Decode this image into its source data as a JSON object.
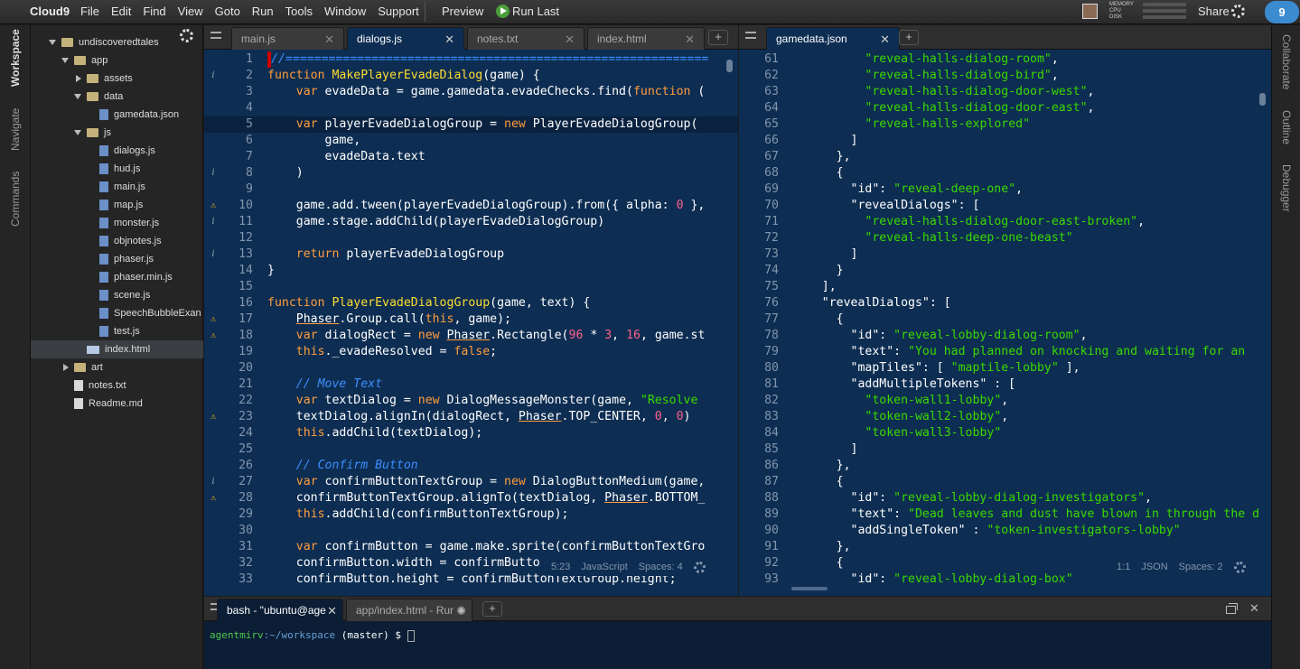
{
  "menubar": {
    "logo": "Cloud9",
    "menus": [
      "File",
      "Edit",
      "Find",
      "View",
      "Goto",
      "Run",
      "Tools",
      "Window",
      "Support"
    ],
    "preview": "Preview",
    "run_last": "Run Last",
    "meters": [
      "MEMORY",
      "CPU",
      "DISK"
    ],
    "share": "Share"
  },
  "left_rail": {
    "tabs": [
      "Workspace",
      "Navigate",
      "Commands"
    ]
  },
  "right_rail": {
    "tabs": [
      "Collaborate",
      "Outline",
      "Debugger"
    ]
  },
  "tree": {
    "items": [
      {
        "label": "undiscoveredtales",
        "type": "folder",
        "open": true,
        "depth": 0
      },
      {
        "label": "app",
        "type": "folder",
        "open": true,
        "depth": 1
      },
      {
        "label": "assets",
        "type": "folder",
        "open": false,
        "depth": 2
      },
      {
        "label": "data",
        "type": "folder",
        "open": true,
        "depth": 2
      },
      {
        "label": "gamedata.json",
        "type": "json",
        "depth": 3
      },
      {
        "label": "js",
        "type": "folder",
        "open": true,
        "depth": 2
      },
      {
        "label": "dialogs.js",
        "type": "js",
        "depth": 3
      },
      {
        "label": "hud.js",
        "type": "js",
        "depth": 3
      },
      {
        "label": "main.js",
        "type": "js",
        "depth": 3
      },
      {
        "label": "map.js",
        "type": "js",
        "depth": 3
      },
      {
        "label": "monster.js",
        "type": "js",
        "depth": 3
      },
      {
        "label": "objnotes.js",
        "type": "js",
        "depth": 3
      },
      {
        "label": "phaser.js",
        "type": "js",
        "depth": 3
      },
      {
        "label": "phaser.min.js",
        "type": "js",
        "depth": 3
      },
      {
        "label": "scene.js",
        "type": "js",
        "depth": 3
      },
      {
        "label": "SpeechBubbleExan",
        "type": "js",
        "depth": 3
      },
      {
        "label": "test.js",
        "type": "js",
        "depth": 3
      },
      {
        "label": "index.html",
        "type": "html",
        "depth": 2,
        "selected": true
      },
      {
        "label": "art",
        "type": "folder",
        "open": false,
        "depth": 1
      },
      {
        "label": "notes.txt",
        "type": "txt",
        "depth": 1
      },
      {
        "label": "Readme.md",
        "type": "txt",
        "depth": 1
      }
    ]
  },
  "left_pane": {
    "tabs": [
      "main.js",
      "dialogs.js",
      "notes.txt",
      "index.html"
    ],
    "active_tab": 1,
    "status": {
      "cursor": "5:23",
      "mode": "JavaScript",
      "spaces": "Spaces: 4"
    },
    "lines": [
      {
        "n": "1",
        "ann": "",
        "t": [
          [
            "c",
            "//==========================================================="
          ]
        ]
      },
      {
        "n": "2",
        "ann": "i",
        "t": [
          [
            "k",
            "function "
          ],
          [
            "f",
            "MakePlayerEvadeDialog"
          ],
          [
            "p",
            "(game) {"
          ]
        ]
      },
      {
        "n": "3",
        "ann": "",
        "t": [
          [
            "p",
            "    "
          ],
          [
            "k",
            "var "
          ],
          [
            "p",
            "evadeData = game.gamedata.evadeChecks."
          ],
          [
            "w",
            "find"
          ],
          [
            "p",
            "("
          ],
          [
            "k",
            "function"
          ],
          [
            "p",
            " ("
          ]
        ]
      },
      {
        "n": "4",
        "ann": "",
        "t": [
          [
            "p",
            ""
          ]
        ]
      },
      {
        "n": "5",
        "ann": "",
        "cur": true,
        "t": [
          [
            "p",
            "    "
          ],
          [
            "k",
            "var "
          ],
          [
            "p",
            "playerEvadeDialogGroup = "
          ],
          [
            "k",
            "new "
          ],
          [
            "p",
            "PlayerEvadeDialogGroup("
          ]
        ]
      },
      {
        "n": "6",
        "ann": "",
        "t": [
          [
            "p",
            "        game,"
          ]
        ]
      },
      {
        "n": "7",
        "ann": "",
        "t": [
          [
            "p",
            "        evadeData.text"
          ]
        ]
      },
      {
        "n": "8",
        "ann": "i",
        "t": [
          [
            "p",
            "    )"
          ]
        ]
      },
      {
        "n": "9",
        "ann": "",
        "t": [
          [
            "p",
            ""
          ]
        ]
      },
      {
        "n": "10",
        "ann": "warn",
        "t": [
          [
            "p",
            "    game.add.tween(playerEvadeDialogGroup).from({ alpha: "
          ],
          [
            "n",
            "0"
          ],
          [
            "p",
            " },"
          ]
        ]
      },
      {
        "n": "11",
        "ann": "i",
        "t": [
          [
            "p",
            "    game.stage.addChild(playerEvadeDialogGroup)"
          ]
        ]
      },
      {
        "n": "12",
        "ann": "",
        "t": [
          [
            "p",
            ""
          ]
        ]
      },
      {
        "n": "13",
        "ann": "i",
        "t": [
          [
            "p",
            "    "
          ],
          [
            "k",
            "return "
          ],
          [
            "p",
            "playerEvadeDialogGroup"
          ]
        ]
      },
      {
        "n": "14",
        "ann": "",
        "t": [
          [
            "p",
            "}"
          ]
        ]
      },
      {
        "n": "15",
        "ann": "",
        "t": [
          [
            "p",
            ""
          ]
        ]
      },
      {
        "n": "16",
        "ann": "",
        "t": [
          [
            "k",
            "function "
          ],
          [
            "f",
            "PlayerEvadeDialogGroup"
          ],
          [
            "p",
            "(game, text) {"
          ]
        ]
      },
      {
        "n": "17",
        "ann": "warn",
        "t": [
          [
            "p",
            "    "
          ],
          [
            "cls",
            "Phaser"
          ],
          [
            "p",
            ".Group.call("
          ],
          [
            "k",
            "this"
          ],
          [
            "p",
            ", game);"
          ]
        ]
      },
      {
        "n": "18",
        "ann": "warn",
        "t": [
          [
            "p",
            "    "
          ],
          [
            "k",
            "var "
          ],
          [
            "p",
            "dialogRect = "
          ],
          [
            "k",
            "new "
          ],
          [
            "cls",
            "Phaser"
          ],
          [
            "p",
            ".Rectangle("
          ],
          [
            "n",
            "96"
          ],
          [
            "p",
            " * "
          ],
          [
            "n",
            "3"
          ],
          [
            "p",
            ", "
          ],
          [
            "n",
            "16"
          ],
          [
            "p",
            ", game.st"
          ]
        ]
      },
      {
        "n": "19",
        "ann": "",
        "t": [
          [
            "p",
            "    "
          ],
          [
            "k",
            "this"
          ],
          [
            "p",
            "._evadeResolved = "
          ],
          [
            "k",
            "false"
          ],
          [
            "p",
            ";"
          ]
        ]
      },
      {
        "n": "20",
        "ann": "",
        "t": [
          [
            "p",
            ""
          ]
        ]
      },
      {
        "n": "21",
        "ann": "",
        "t": [
          [
            "p",
            "    "
          ],
          [
            "c",
            "// Move Text"
          ]
        ]
      },
      {
        "n": "22",
        "ann": "",
        "t": [
          [
            "p",
            "    "
          ],
          [
            "k",
            "var "
          ],
          [
            "p",
            "textDialog = "
          ],
          [
            "k",
            "new "
          ],
          [
            "p",
            "DialogMessageMonster(game, "
          ],
          [
            "s",
            "\"Resolve"
          ]
        ]
      },
      {
        "n": "23",
        "ann": "warn",
        "t": [
          [
            "p",
            "    textDialog.alignIn(dialogRect, "
          ],
          [
            "cls",
            "Phaser"
          ],
          [
            "p",
            ".TOP_CENTER, "
          ],
          [
            "n",
            "0"
          ],
          [
            "p",
            ", "
          ],
          [
            "n",
            "0"
          ],
          [
            "p",
            ")"
          ]
        ]
      },
      {
        "n": "24",
        "ann": "",
        "t": [
          [
            "p",
            "    "
          ],
          [
            "k",
            "this"
          ],
          [
            "p",
            ".addChild(textDialog);"
          ]
        ]
      },
      {
        "n": "25",
        "ann": "",
        "t": [
          [
            "p",
            ""
          ]
        ]
      },
      {
        "n": "26",
        "ann": "",
        "t": [
          [
            "p",
            "    "
          ],
          [
            "c",
            "// Confirm Button"
          ]
        ]
      },
      {
        "n": "27",
        "ann": "i",
        "t": [
          [
            "p",
            "    "
          ],
          [
            "k",
            "var "
          ],
          [
            "p",
            "confirmButtonTextGroup = "
          ],
          [
            "k",
            "new "
          ],
          [
            "p",
            "DialogButtonMedium(game,"
          ]
        ]
      },
      {
        "n": "28",
        "ann": "warn",
        "t": [
          [
            "p",
            "    confirmButtonTextGroup.alignTo(textDialog, "
          ],
          [
            "cls",
            "Phaser"
          ],
          [
            "p",
            ".BOTTOM_"
          ]
        ]
      },
      {
        "n": "29",
        "ann": "",
        "t": [
          [
            "p",
            "    "
          ],
          [
            "k",
            "this"
          ],
          [
            "p",
            ".addChild(confirmButtonTextGroup);"
          ]
        ]
      },
      {
        "n": "30",
        "ann": "",
        "t": [
          [
            "p",
            ""
          ]
        ]
      },
      {
        "n": "31",
        "ann": "",
        "t": [
          [
            "p",
            "    "
          ],
          [
            "k",
            "var "
          ],
          [
            "p",
            "confirmButton = game.make.sprite(confirmButtonTextGro"
          ]
        ]
      },
      {
        "n": "32",
        "ann": "",
        "t": [
          [
            "p",
            "    confirmButton.width = confirmButto"
          ]
        ]
      },
      {
        "n": "33",
        "ann": "",
        "t": [
          [
            "p",
            "    confirmButton.height = confirmButtonTextGroup.height;"
          ]
        ]
      }
    ]
  },
  "right_pane": {
    "tabs": [
      "gamedata.json"
    ],
    "active_tab": 0,
    "status": {
      "cursor": "1:1",
      "mode": "JSON",
      "spaces": "Spaces: 2"
    },
    "lines": [
      {
        "n": "61",
        "t": [
          [
            "p",
            "          "
          ],
          [
            "s",
            "\"reveal-halls-dialog-room\""
          ],
          [
            "p",
            ","
          ]
        ]
      },
      {
        "n": "62",
        "t": [
          [
            "p",
            "          "
          ],
          [
            "s",
            "\"reveal-halls-dialog-bird\""
          ],
          [
            "p",
            ","
          ]
        ]
      },
      {
        "n": "63",
        "t": [
          [
            "p",
            "          "
          ],
          [
            "s",
            "\"reveal-halls-dialog-door-west\""
          ],
          [
            "p",
            ","
          ]
        ]
      },
      {
        "n": "64",
        "t": [
          [
            "p",
            "          "
          ],
          [
            "s",
            "\"reveal-halls-dialog-door-east\""
          ],
          [
            "p",
            ","
          ]
        ]
      },
      {
        "n": "65",
        "t": [
          [
            "p",
            "          "
          ],
          [
            "s",
            "\"reveal-halls-explored\""
          ]
        ]
      },
      {
        "n": "66",
        "t": [
          [
            "p",
            "        ]"
          ]
        ]
      },
      {
        "n": "67",
        "t": [
          [
            "p",
            "      },"
          ]
        ]
      },
      {
        "n": "68",
        "t": [
          [
            "p",
            "      {"
          ]
        ]
      },
      {
        "n": "69",
        "t": [
          [
            "p",
            "        \"id\": "
          ],
          [
            "s",
            "\"reveal-deep-one\""
          ],
          [
            "p",
            ","
          ]
        ]
      },
      {
        "n": "70",
        "t": [
          [
            "p",
            "        \"revealDialogs\": ["
          ]
        ]
      },
      {
        "n": "71",
        "t": [
          [
            "p",
            "          "
          ],
          [
            "s",
            "\"reveal-halls-dialog-door-east-broken\""
          ],
          [
            "p",
            ","
          ]
        ]
      },
      {
        "n": "72",
        "t": [
          [
            "p",
            "          "
          ],
          [
            "s",
            "\"reveal-halls-deep-one-beast\""
          ]
        ]
      },
      {
        "n": "73",
        "t": [
          [
            "p",
            "        ]"
          ]
        ]
      },
      {
        "n": "74",
        "t": [
          [
            "p",
            "      }"
          ]
        ]
      },
      {
        "n": "75",
        "t": [
          [
            "p",
            "    ],"
          ]
        ]
      },
      {
        "n": "76",
        "t": [
          [
            "p",
            "    \"revealDialogs\": ["
          ]
        ]
      },
      {
        "n": "77",
        "t": [
          [
            "p",
            "      {"
          ]
        ]
      },
      {
        "n": "78",
        "t": [
          [
            "p",
            "        \"id\": "
          ],
          [
            "s",
            "\"reveal-lobby-dialog-room\""
          ],
          [
            "p",
            ","
          ]
        ]
      },
      {
        "n": "79",
        "t": [
          [
            "p",
            "        \"text\": "
          ],
          [
            "s",
            "\"You had planned on knocking and waiting for an"
          ]
        ]
      },
      {
        "n": "80",
        "t": [
          [
            "p",
            "        \"mapTiles\": [ "
          ],
          [
            "s",
            "\"maptile-lobby\""
          ],
          [
            "p",
            " ],"
          ]
        ]
      },
      {
        "n": "81",
        "t": [
          [
            "p",
            "        \"addMultipleTokens\" : ["
          ]
        ]
      },
      {
        "n": "82",
        "t": [
          [
            "p",
            "          "
          ],
          [
            "s",
            "\"token-wall1-lobby\""
          ],
          [
            "p",
            ","
          ]
        ]
      },
      {
        "n": "83",
        "t": [
          [
            "p",
            "          "
          ],
          [
            "s",
            "\"token-wall2-lobby\""
          ],
          [
            "p",
            ","
          ]
        ]
      },
      {
        "n": "84",
        "t": [
          [
            "p",
            "          "
          ],
          [
            "s",
            "\"token-wall3-lobby\""
          ]
        ]
      },
      {
        "n": "85",
        "t": [
          [
            "p",
            "        ]"
          ]
        ]
      },
      {
        "n": "86",
        "t": [
          [
            "p",
            "      },"
          ]
        ]
      },
      {
        "n": "87",
        "t": [
          [
            "p",
            "      {"
          ]
        ]
      },
      {
        "n": "88",
        "t": [
          [
            "p",
            "        \"id\": "
          ],
          [
            "s",
            "\"reveal-lobby-dialog-investigators\""
          ],
          [
            "p",
            ","
          ]
        ]
      },
      {
        "n": "89",
        "t": [
          [
            "p",
            "        \"text\": "
          ],
          [
            "s",
            "\"Dead leaves and dust have blown in through the d"
          ]
        ]
      },
      {
        "n": "90",
        "t": [
          [
            "p",
            "        \"addSingleToken\" : "
          ],
          [
            "s",
            "\"token-investigators-lobby\""
          ]
        ]
      },
      {
        "n": "91",
        "t": [
          [
            "p",
            "      },"
          ]
        ]
      },
      {
        "n": "92",
        "t": [
          [
            "p",
            "      {"
          ]
        ]
      },
      {
        "n": "93",
        "t": [
          [
            "p",
            "        \"id\": "
          ],
          [
            "s",
            "\"reveal-lobby-dialog-box\""
          ]
        ]
      }
    ]
  },
  "terminal": {
    "tabs": [
      "bash - \"ubuntu@age",
      "app/index.html - Rur"
    ],
    "user": "agentmirv",
    "path": ":~/workspace",
    "branch": " (master) $ "
  }
}
